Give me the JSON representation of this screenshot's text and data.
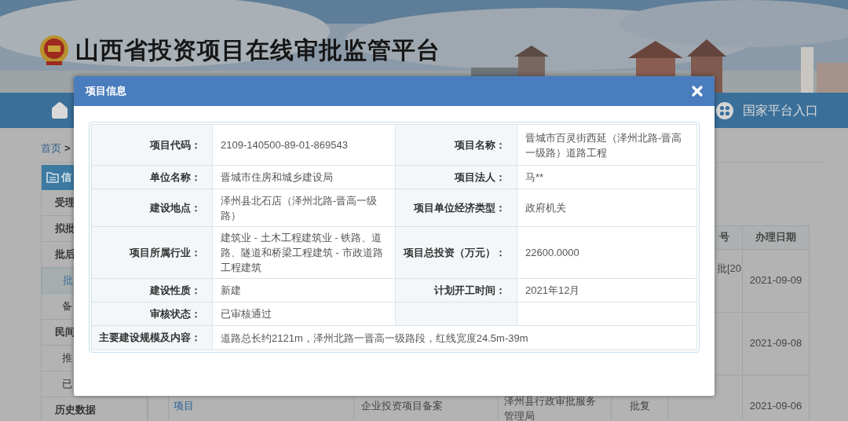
{
  "header": {
    "title": "山西省投资项目在线审批监管平台"
  },
  "nav": {
    "right_link": "国家平台入口"
  },
  "breadcrumb": {
    "home": "首页",
    "separator": ">"
  },
  "sidebar": {
    "heading": "信",
    "items": [
      {
        "label": "受理",
        "kind": "group",
        "selected": false
      },
      {
        "label": "拟批",
        "kind": "group",
        "selected": false
      },
      {
        "label": "批后",
        "kind": "group",
        "selected": false
      },
      {
        "label": "批",
        "kind": "sub",
        "selected": true
      },
      {
        "label": "备",
        "kind": "sub",
        "selected": false
      },
      {
        "label": "民间",
        "kind": "group",
        "selected": false
      },
      {
        "label": "推",
        "kind": "sub",
        "selected": false
      },
      {
        "label": "已",
        "kind": "sub",
        "selected": false
      },
      {
        "label": "历史数据",
        "kind": "group",
        "selected": false
      }
    ]
  },
  "table": {
    "columns": [
      "号",
      "办理日期"
    ],
    "rows": [
      {
        "column_6": "批[20",
        "date": "2021-09-09"
      },
      {
        "date": "2021-09-08"
      },
      {
        "project": "项目",
        "type": "企业投资项目备案",
        "agency": "泽州县行政审批服务管理局",
        "result": "批复",
        "date": "2021-09-06"
      }
    ]
  },
  "modal": {
    "title": "项目信息",
    "rows": [
      {
        "kind": "pair",
        "fields": [
          {
            "label": "项目代码：",
            "value": "2109-140500-89-01-869543"
          },
          {
            "label": "项目名称：",
            "value": "晋城市百灵街西延（泽州北路-晋高一级路）道路工程"
          }
        ]
      },
      {
        "kind": "pair",
        "fields": [
          {
            "label": "单位名称：",
            "value": "晋城市住房和城乡建设局"
          },
          {
            "label": "项目法人：",
            "value": "马**"
          }
        ]
      },
      {
        "kind": "pair",
        "fields": [
          {
            "label": "建设地点：",
            "value": "泽州县北石店（泽州北路-晋高一级路）"
          },
          {
            "label": "项目单位经济类型：",
            "value": "政府机关"
          }
        ]
      },
      {
        "kind": "pair",
        "fields": [
          {
            "label": "项目所属行业：",
            "value": "建筑业 - 土木工程建筑业 - 铁路、道路、隧道和桥梁工程建筑 - 市政道路工程建筑"
          },
          {
            "label": "项目总投资（万元）：",
            "value": "22600.0000"
          }
        ]
      },
      {
        "kind": "pair",
        "fields": [
          {
            "label": "建设性质：",
            "value": "新建"
          },
          {
            "label": "计划开工时间：",
            "value": "2021年12月"
          }
        ]
      },
      {
        "kind": "pair",
        "fields": [
          {
            "label": "审核状态：",
            "value": "已审核通过"
          }
        ]
      },
      {
        "kind": "wide",
        "fields": [
          {
            "label": "主要建设规模及内容：",
            "value": "道路总长约2121m，泽州北路一晋高一级路段，红线宽度24.5m-39m"
          }
        ]
      }
    ]
  }
}
